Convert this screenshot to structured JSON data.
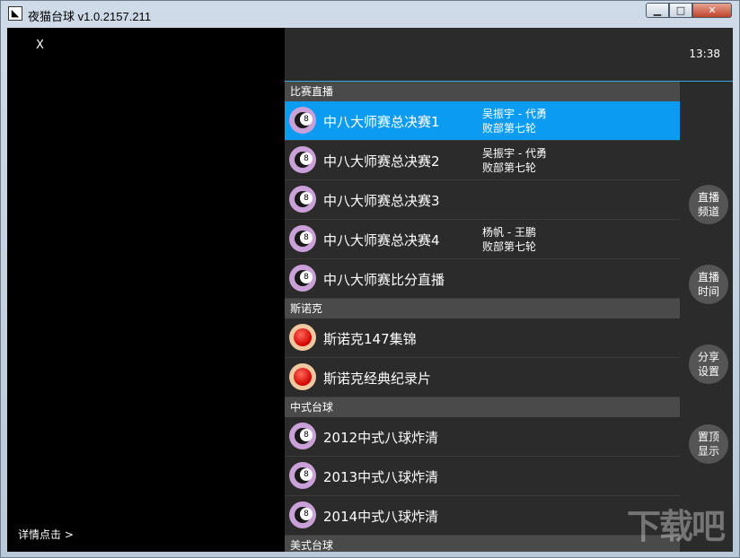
{
  "window": {
    "title": "夜猫台球 v1.0.2157.211",
    "minimize_label": "▁",
    "maximize_label": "□",
    "close_label": "✕"
  },
  "player": {
    "close_label": "X",
    "detail_label": "详情点击 >"
  },
  "clock": "13:38",
  "sections": [
    {
      "title": "比赛直播",
      "items": [
        {
          "title": "中八大师赛总决赛1",
          "sub1": "吴振宇 - 代勇",
          "sub2": "败部第七轮",
          "icon": "pool-8-ball-icon"
        },
        {
          "title": "中八大师赛总决赛2",
          "sub1": "吴振宇 - 代勇",
          "sub2": "败部第七轮",
          "icon": "pool-8-ball-icon"
        },
        {
          "title": "中八大师赛总决赛3",
          "sub1": "",
          "sub2": "",
          "icon": "pool-8-ball-icon"
        },
        {
          "title": "中八大师赛总决赛4",
          "sub1": "杨帆 - 王鹏",
          "sub2": "败部第七轮",
          "icon": "pool-8-ball-icon"
        },
        {
          "title": "中八大师赛比分直播",
          "sub1": "",
          "sub2": "",
          "icon": "pool-8-ball-icon"
        }
      ]
    },
    {
      "title": "斯诺克",
      "items": [
        {
          "title": "斯诺克147集锦",
          "icon": "snooker-red-ball-icon"
        },
        {
          "title": "斯诺克经典纪录片",
          "icon": "snooker-red-ball-icon"
        }
      ]
    },
    {
      "title": "中式台球",
      "items": [
        {
          "title": "2012中式八球炸清",
          "icon": "pool-8-ball-icon"
        },
        {
          "title": "2013中式八球炸清",
          "icon": "pool-8-ball-icon"
        },
        {
          "title": "2014中式八球炸清",
          "icon": "pool-8-ball-icon"
        }
      ]
    },
    {
      "title": "美式台球",
      "items": []
    }
  ],
  "ball_number": "8",
  "selected_item": "中八大师赛总决赛1",
  "sidebar": {
    "live_channel": {
      "line1": "直播",
      "line2": "频道"
    },
    "live_time": {
      "line1": "直播",
      "line2": "时间"
    },
    "share_settings": {
      "line1": "分享",
      "line2": "设置"
    },
    "pin_top": {
      "line1": "置顶",
      "line2": "显示"
    }
  },
  "colors": {
    "accent": "#0b9cf2",
    "section_header": "#4a4a4a",
    "panel": "#2b2b2b",
    "pool_ball": "#caa0d8",
    "snooker_ball": "#d00000"
  },
  "watermark": "下载吧"
}
